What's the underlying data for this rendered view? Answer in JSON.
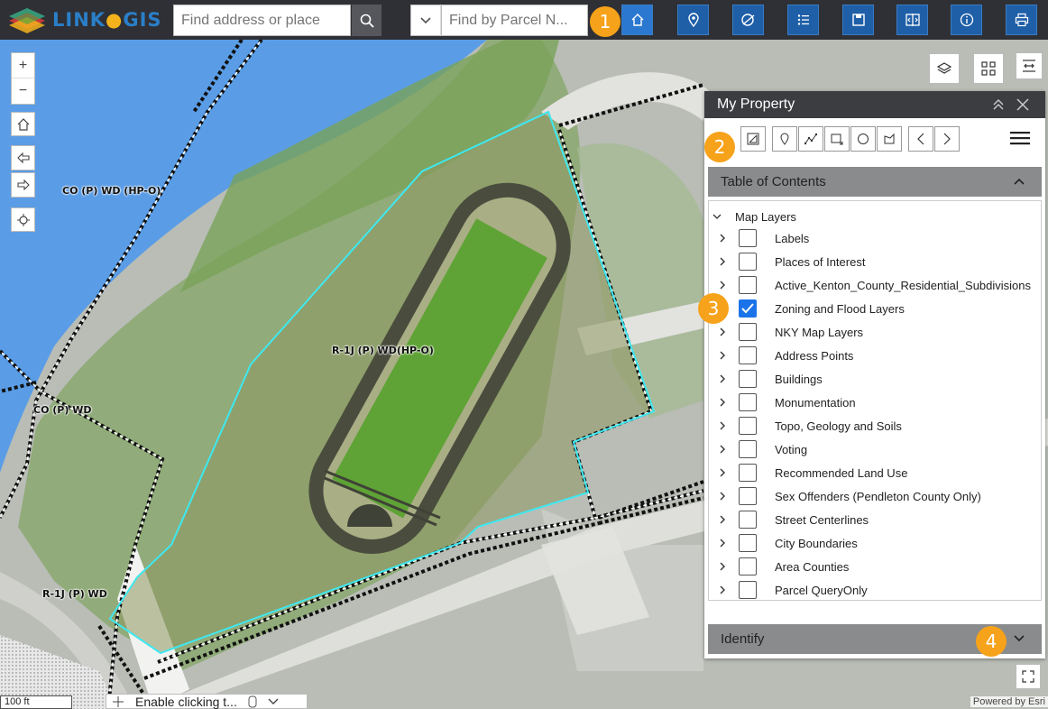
{
  "app": {
    "logo_text_a": "LINK",
    "logo_text_b": "GIS"
  },
  "search": {
    "address_placeholder": "Find address or place",
    "parcel_placeholder": "Find by Parcel N..."
  },
  "toolbar": {
    "icons": [
      "home-icon",
      "pin-icon",
      "tag-icon",
      "list-icon",
      "save-icon",
      "compare-icon",
      "info-icon",
      "print-icon"
    ]
  },
  "badges": [
    "1",
    "2",
    "3",
    "4"
  ],
  "map": {
    "labels": {
      "co_wd_hpo": "CO (P) WD (HP-O)",
      "r1j_hpo": "R-1J (P) WD(HP-O)",
      "co_wd": "CO (P) WD",
      "r1j_wd": "R-1J (P) WD"
    },
    "zoom_in": "+",
    "zoom_out": "−",
    "scale": "100 ft",
    "enable_text": "Enable clicking t...",
    "powered_by": "Powered by Esri"
  },
  "panel": {
    "title": "My Property",
    "toc_title": "Table of Contents",
    "identify_title": "Identify",
    "root_label": "Map Layers",
    "layers": [
      {
        "name": "Labels",
        "checked": false,
        "expandable": true
      },
      {
        "name": "Places of Interest",
        "checked": false,
        "expandable": true
      },
      {
        "name": "Active_Kenton_County_Residential_Subdivisions",
        "checked": false,
        "expandable": true
      },
      {
        "name": "Zoning and Flood Layers",
        "checked": true,
        "expandable": false
      },
      {
        "name": "NKY Map Layers",
        "checked": false,
        "expandable": true
      },
      {
        "name": "Address Points",
        "checked": false,
        "expandable": true
      },
      {
        "name": "Buildings",
        "checked": false,
        "expandable": true
      },
      {
        "name": "Monumentation",
        "checked": false,
        "expandable": true
      },
      {
        "name": "Topo, Geology and Soils",
        "checked": false,
        "expandable": true
      },
      {
        "name": "Voting",
        "checked": false,
        "expandable": true
      },
      {
        "name": "Recommended Land Use",
        "checked": false,
        "expandable": true
      },
      {
        "name": "Sex Offenders (Pendleton County Only)",
        "checked": false,
        "expandable": true
      },
      {
        "name": "Street Centerlines",
        "checked": false,
        "expandable": true
      },
      {
        "name": "City Boundaries",
        "checked": false,
        "expandable": true
      },
      {
        "name": "Area Counties",
        "checked": false,
        "expandable": true
      },
      {
        "name": "Parcel QueryOnly",
        "checked": false,
        "expandable": true
      }
    ]
  },
  "colors": {
    "accent": "#1f5fa8",
    "badge": "#f6a21a",
    "parcel_outline": "#3ee8f0",
    "water": "#5a9de6",
    "check": "#1a73e8"
  }
}
